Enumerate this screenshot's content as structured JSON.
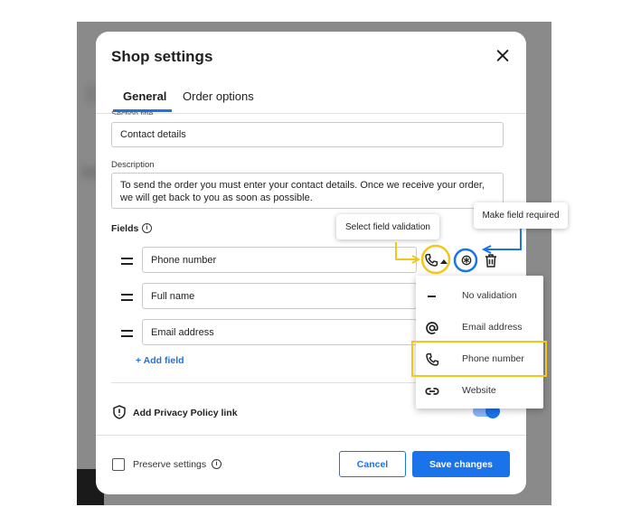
{
  "colors": {
    "accent": "#1a73e8",
    "annotation_yellow": "#f5c518",
    "annotation_blue": "#1a73e8"
  },
  "dialog": {
    "title": "Shop settings",
    "close_icon": "close-icon",
    "tabs": [
      {
        "label": "General",
        "active": true
      },
      {
        "label": "Order options",
        "active": false
      }
    ],
    "section_title_label": "Section title",
    "section_title_value": "Contact details",
    "description_label": "Description",
    "description_value": "To send the order you must enter your contact details. Once we receive your order, we will get back to you as soon as possible.",
    "fields_label": "Fields",
    "fields": [
      {
        "value": "Phone number"
      },
      {
        "value": "Full name"
      },
      {
        "value": "Email address"
      }
    ],
    "add_field_label": "+ Add field",
    "privacy_label": "Add Privacy Policy link",
    "privacy_enabled": true,
    "preserve_label": "Preserve settings",
    "preserve_checked": false,
    "cancel_label": "Cancel",
    "save_label": "Save changes"
  },
  "annotations": {
    "validation_tooltip": "Select field validation",
    "required_tooltip": "Make field required"
  },
  "validation_menu": {
    "items": [
      {
        "label": "No validation",
        "icon": "dash-icon"
      },
      {
        "label": "Email address",
        "icon": "at-icon"
      },
      {
        "label": "Phone number",
        "icon": "phone-icon",
        "highlighted": true
      },
      {
        "label": "Website",
        "icon": "link-icon"
      }
    ]
  }
}
